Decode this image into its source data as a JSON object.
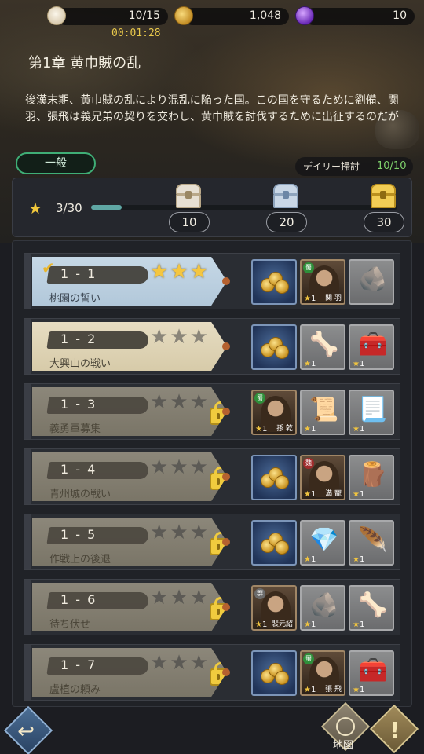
{
  "resources": {
    "stamina": "10/15",
    "coins": "1,048",
    "gems": "10",
    "timer": "00:01:28"
  },
  "chapter": {
    "title": "第1章 黄巾賊の乱",
    "description": "後漢末期、黄巾賊の乱により混乱に陥った国。この国を守るために劉備、関羽、張飛は義兄弟の契りを交わし、黄巾賊を討伐するために出征するのだが"
  },
  "mode_button": "一般",
  "daily": {
    "label": "デイリー掃討",
    "value": "10/10"
  },
  "progress": {
    "stars": "3/30",
    "fraction": 0.1,
    "milestones": [
      "10",
      "20",
      "30"
    ]
  },
  "stages": [
    {
      "number": "1 - 1",
      "name": "桃園の誓い",
      "stars": 3,
      "state": "cleared",
      "rewards": [
        {
          "type": "coins"
        },
        {
          "type": "hero",
          "faction": "蜀",
          "qty": "1",
          "hero_name": "関 羽"
        },
        {
          "type": "item",
          "icon": "stone",
          "glyph": "🪨"
        }
      ]
    },
    {
      "number": "1 - 2",
      "name": "大興山の戦い",
      "stars": 0,
      "state": "open",
      "rewards": [
        {
          "type": "coins"
        },
        {
          "type": "item",
          "icon": "bone",
          "qty": "1",
          "glyph": "🦴"
        },
        {
          "type": "item",
          "icon": "anvil",
          "qty": "1",
          "glyph": "🧰"
        }
      ]
    },
    {
      "number": "1 - 3",
      "name": "義勇軍募集",
      "stars": 0,
      "state": "locked",
      "rewards": [
        {
          "type": "hero",
          "faction": "蜀",
          "qty": "1",
          "hero_name": "孫 乾"
        },
        {
          "type": "item",
          "icon": "scroll",
          "qty": "1",
          "glyph": "📜"
        },
        {
          "type": "item",
          "icon": "parchment",
          "qty": "1",
          "glyph": "📃"
        }
      ]
    },
    {
      "number": "1 - 4",
      "name": "青州城の戦い",
      "stars": 0,
      "state": "locked",
      "rewards": [
        {
          "type": "coins"
        },
        {
          "type": "hero",
          "faction": "魏",
          "qty": "1",
          "hero_name": "満 寵"
        },
        {
          "type": "item",
          "icon": "plank",
          "qty": "1",
          "glyph": "🪵"
        }
      ]
    },
    {
      "number": "1 - 5",
      "name": "作戦上の後退",
      "stars": 0,
      "state": "locked",
      "rewards": [
        {
          "type": "coins"
        },
        {
          "type": "item",
          "icon": "crystal",
          "qty": "1",
          "glyph": "💎"
        },
        {
          "type": "item",
          "icon": "feather",
          "qty": "1",
          "glyph": "🪶"
        }
      ]
    },
    {
      "number": "1 - 6",
      "name": "待ち伏せ",
      "stars": 0,
      "state": "locked",
      "rewards": [
        {
          "type": "hero",
          "faction": "群",
          "qty": "1",
          "hero_name": "裴元紹"
        },
        {
          "type": "item",
          "icon": "stone",
          "qty": "1",
          "glyph": "🪨"
        },
        {
          "type": "item",
          "icon": "bone",
          "qty": "1",
          "glyph": "🦴"
        }
      ]
    },
    {
      "number": "1 - 7",
      "name": "盧植の頼み",
      "stars": 0,
      "state": "locked",
      "rewards": [
        {
          "type": "coins"
        },
        {
          "type": "hero",
          "faction": "蜀",
          "qty": "1",
          "hero_name": "張 飛"
        },
        {
          "type": "item",
          "icon": "anvil",
          "qty": "1",
          "glyph": "🧰"
        }
      ]
    }
  ],
  "map_label": "地図",
  "colors": {
    "accent_gold": "#f4c640",
    "active_green": "#3fae76",
    "progress_fill": "#5fa7a4"
  }
}
